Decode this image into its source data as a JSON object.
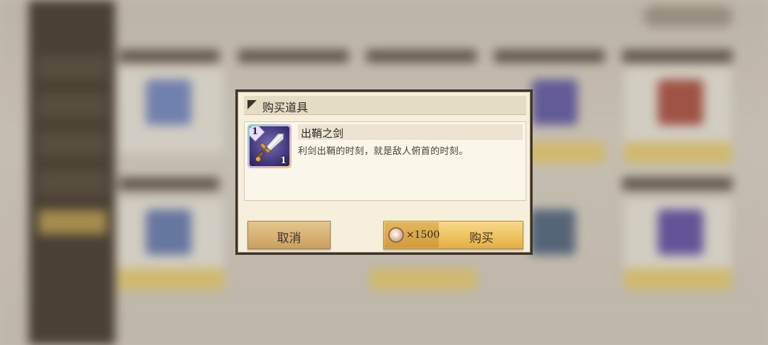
{
  "dialog": {
    "title": "购买道具",
    "item": {
      "name": "出鞘之剑",
      "description": "利剑出鞘的时刻，就是敌人俯首的时刻。",
      "tier": "1",
      "quantity": "1",
      "icon": "sword-icon"
    },
    "cancel_label": "取消",
    "buy_label": "购买",
    "price": "×1500",
    "currency_icon": "coin-icon"
  },
  "colors": {
    "dialog_border": "#3e3429",
    "dialog_bg": "#f5efdc",
    "buy_button": "#eec462",
    "cancel_button": "#d7b274"
  }
}
